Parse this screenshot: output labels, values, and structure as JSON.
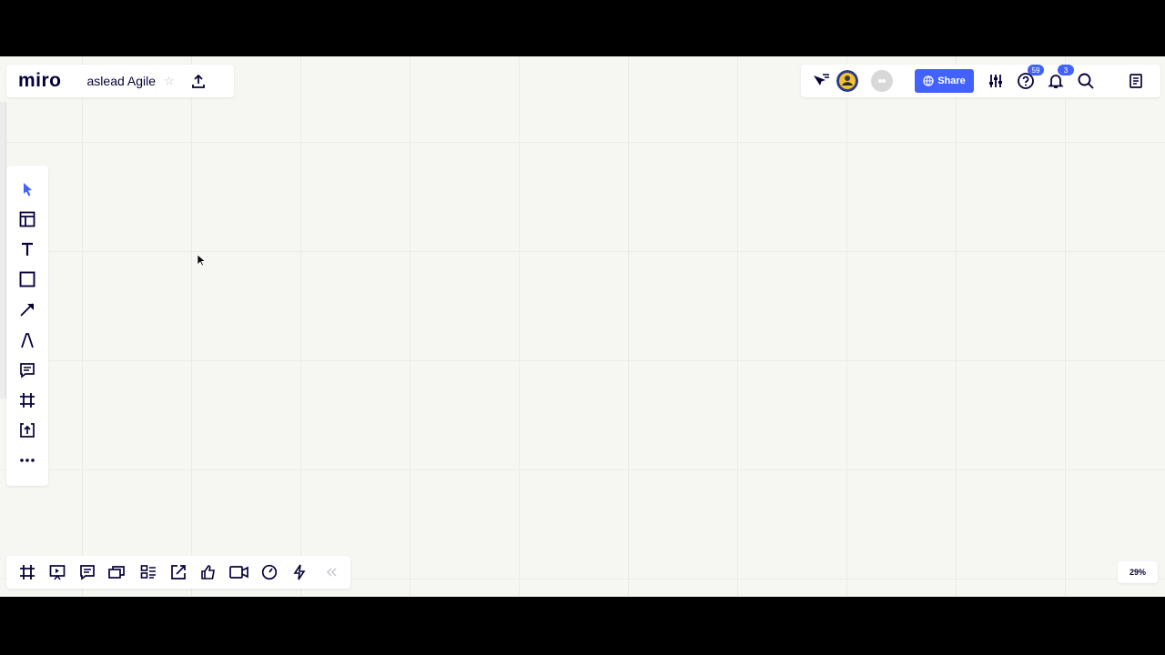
{
  "app": {
    "logo": "miro",
    "board_name": "aslead Agile"
  },
  "topbar": {
    "share_label": "Share",
    "help_badge": "59",
    "notifications_badge": "3",
    "icons": [
      "export-icon",
      "star-icon",
      "cursor-filter-icon",
      "avatar",
      "avatar-placeholder",
      "globe-icon",
      "settings-sliders-icon",
      "help-icon",
      "bell-icon",
      "search-icon",
      "notes-icon"
    ]
  },
  "left_toolbar": {
    "tools": [
      "select-tool",
      "templates-tool",
      "text-tool",
      "shape-tool",
      "connection-line-tool",
      "pen-tool",
      "comment-tool",
      "frame-tool",
      "upload-tool",
      "more-tools"
    ]
  },
  "bottom_toolbar": {
    "tools": [
      "frames-button",
      "presentation-button",
      "comments-button",
      "card-button",
      "kanban-button",
      "screen-share-button",
      "voting-button",
      "video-chat-button",
      "timer-button",
      "apps-button",
      "collapse-button"
    ]
  },
  "zoom": {
    "level": "29%"
  },
  "colors": {
    "accent": "#4262ff",
    "ink": "#050038",
    "canvas": "#f6f6f3"
  }
}
